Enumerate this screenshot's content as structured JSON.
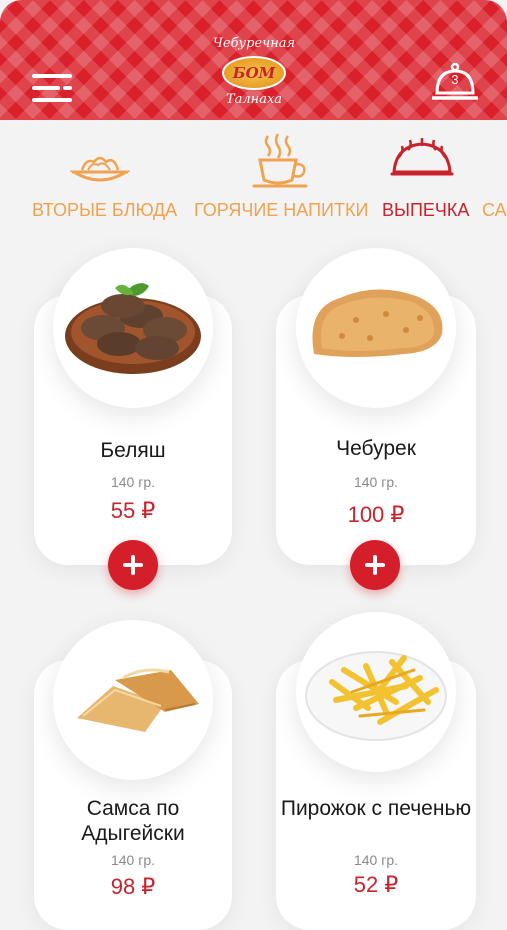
{
  "header": {
    "logo_top_text": "Чебуречная",
    "logo_center_text": "БОМ",
    "logo_bottom_text": "Талнаха",
    "cart_count": "3",
    "accent_color": "#d9202b"
  },
  "categories": [
    {
      "label": "ВТОРЫЕ БЛЮДА",
      "icon": "noodle-plate-icon",
      "active": false
    },
    {
      "label": "ГОРЯЧИЕ НАПИТКИ",
      "icon": "coffee-cup-icon",
      "active": false
    },
    {
      "label": "ВЫПЕЧКА",
      "icon": "pastry-icon",
      "active": true
    },
    {
      "label": "СА",
      "icon": "",
      "active": false
    }
  ],
  "products": [
    {
      "name": "Беляш",
      "weight": "140 гр.",
      "price": "55 ₽",
      "image": "meat-patties-image"
    },
    {
      "name": "Чебурек",
      "weight": "140 гр.",
      "price": "100 ₽",
      "image": "cheburek-image"
    },
    {
      "name": "Самса по Адыгейски",
      "weight": "140 гр.",
      "price": "98 ₽",
      "image": "samsa-image"
    },
    {
      "name": "Пирожок с печенью",
      "weight": "140 гр.",
      "price": "52 ₽",
      "image": "french-fries-image"
    }
  ]
}
